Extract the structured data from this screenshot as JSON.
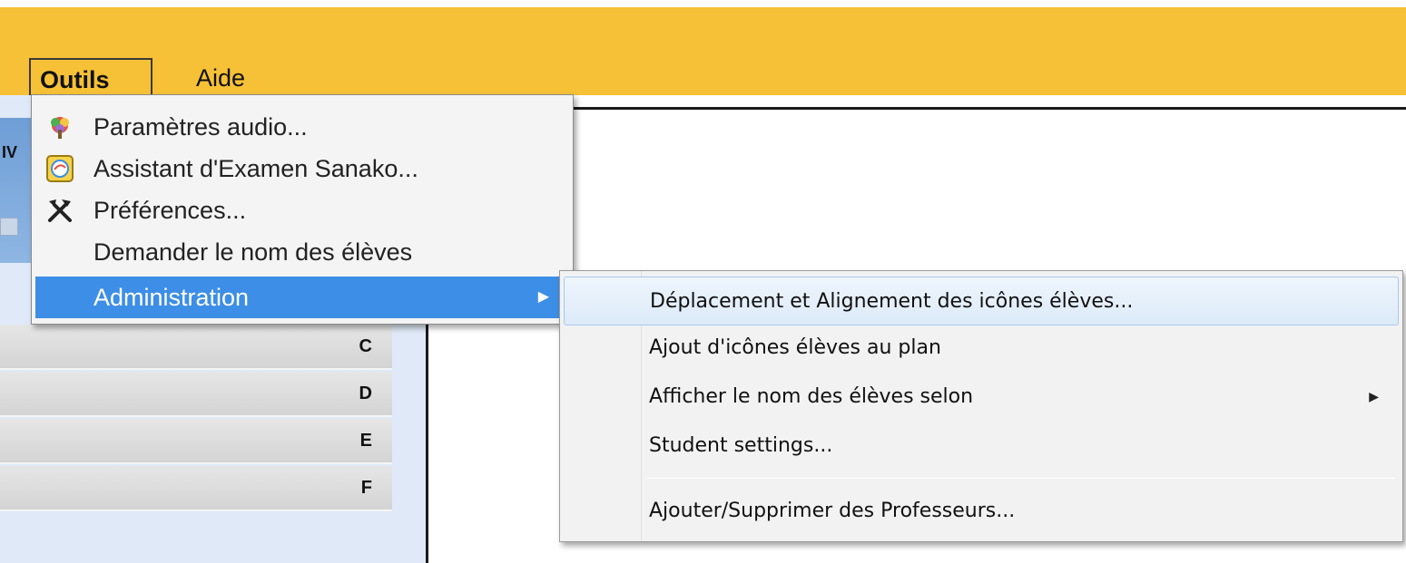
{
  "menubar": {
    "items": [
      {
        "label": "Outils",
        "state": "open"
      },
      {
        "label": "Aide"
      }
    ]
  },
  "left_pane": {
    "glyph": "IV",
    "rows": [
      "C",
      "D",
      "E",
      "F"
    ]
  },
  "tools_menu": {
    "items": [
      {
        "label": "Paramètres audio...",
        "icon": "audio-settings-icon"
      },
      {
        "label": "Assistant d'Examen Sanako...",
        "icon": "exam-assistant-icon"
      },
      {
        "label": "Préférences...",
        "icon": "tools-icon"
      },
      {
        "label": "Demander le nom des élèves",
        "icon": ""
      },
      {
        "label": "Administration",
        "icon": "",
        "selected": true,
        "submenu_indicator": "▶"
      }
    ]
  },
  "admin_submenu": {
    "items": [
      {
        "label": "Déplacement et Alignement des icônes élèves...",
        "hover": true
      },
      {
        "label": "Ajout d'icônes élèves au plan"
      },
      {
        "label": "Afficher le nom des élèves selon",
        "submenu_indicator": "▶"
      },
      {
        "label": "Student settings..."
      },
      {
        "label": "Ajouter/Supprimer des Professeurs..."
      }
    ]
  },
  "colors": {
    "menubar": "#f6c136",
    "selection": "#3d8ee6",
    "hover": "#dceaf8"
  }
}
